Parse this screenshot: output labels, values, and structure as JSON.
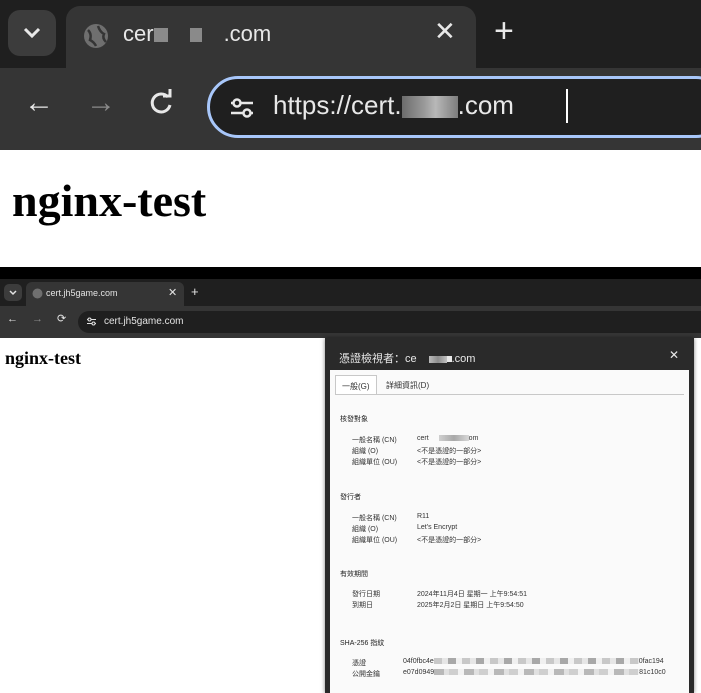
{
  "zoom": {
    "tab_title_prefix": "cer",
    "tab_title_suffix": ".com",
    "url_prefix": "https://cert.",
    "url_suffix": ".com",
    "page_heading": "nginx-test"
  },
  "small": {
    "tab_title": "cert.jh5game.com",
    "url": "cert.jh5game.com",
    "page_heading": "nginx-test"
  },
  "cert_viewer": {
    "title_prefix": "憑證檢視者：ce",
    "title_suffix": ".com",
    "tabs": [
      "一般(G)",
      "詳細資訊(D)"
    ],
    "issued_to": {
      "heading": "核發對象",
      "cn_label": "一般名稱 (CN)",
      "cn_value_prefix": "cert",
      "cn_value_suffix": "om",
      "o_label": "組織 (O)",
      "o_value": "<不是憑證的一部分>",
      "ou_label": "組織單位 (OU)",
      "ou_value": "<不是憑證的一部分>"
    },
    "issuer": {
      "heading": "發行者",
      "cn_label": "一般名稱 (CN)",
      "cn_value": "R11",
      "o_label": "組織 (O)",
      "o_value": "Let's Encrypt",
      "ou_label": "組織單位 (OU)",
      "ou_value": "<不是憑證的一部分>"
    },
    "validity": {
      "heading": "有效期間",
      "issued_label": "發行日期",
      "issued_value": "2024年11月4日 星期一 上午9:54:51",
      "expires_label": "到期日",
      "expires_value": "2025年2月2日 星期日 上午9:54:50"
    },
    "fingerprints": {
      "heading": "SHA-256 指紋",
      "cert_label": "憑證",
      "cert_prefix": "04f0fbc4e",
      "cert_suffix": "0fac194",
      "key_label": "公開金鑰",
      "key_prefix": "e07d0949",
      "key_suffix": "81c10c0"
    }
  },
  "colors": {
    "chrome_dark": "#1f1f1f",
    "chrome_tab": "#353535",
    "omnibox_focus": "#a8c7fa"
  }
}
